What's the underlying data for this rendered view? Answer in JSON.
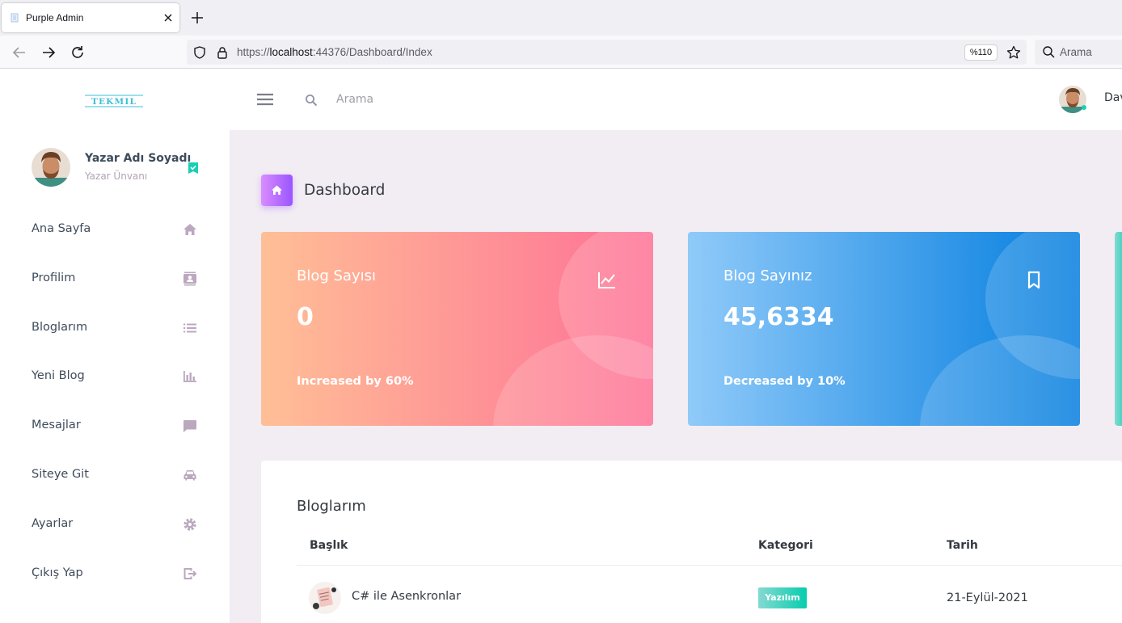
{
  "browser": {
    "tab_title": "Purple Admin",
    "url_scheme": "https://",
    "url_host": "localhost",
    "url_path": ":44376/Dashboard/Index",
    "zoom": "%110",
    "search_placeholder": "Arama"
  },
  "header": {
    "logo_text": "TEKMIL",
    "search_placeholder": "Arama",
    "user_name": "Dav"
  },
  "sidebar": {
    "user_name": "Yazar Adı Soyadı",
    "user_title": "Yazar Ünvanı",
    "items": [
      {
        "label": "Ana Sayfa",
        "icon": "home-icon"
      },
      {
        "label": "Profilim",
        "icon": "contacts-icon"
      },
      {
        "label": "Bloglarım",
        "icon": "format-list-icon"
      },
      {
        "label": "Yeni Blog",
        "icon": "chart-bar-icon"
      },
      {
        "label": "Mesajlar",
        "icon": "message-icon"
      },
      {
        "label": "Siteye Git",
        "icon": "car-icon"
      },
      {
        "label": "Ayarlar",
        "icon": "settings-icon"
      },
      {
        "label": "Çıkış Yap",
        "icon": "logout-icon"
      }
    ]
  },
  "page": {
    "title": "Dashboard"
  },
  "cards": [
    {
      "title": "Blog Sayısı",
      "value": "0",
      "footer": "Increased by 60%",
      "icon": "chart-line-icon"
    },
    {
      "title": "Blog Sayınız",
      "value": "45,6334",
      "footer": "Decreased by 10%",
      "icon": "bookmark-icon"
    }
  ],
  "blogs_table": {
    "title": "Bloglarım",
    "columns": [
      "Başlık",
      "Kategori",
      "Tarih"
    ],
    "rows": [
      {
        "title": "C# ile Asenkronlar",
        "category": "Yazılım",
        "date": "21-Eylül-2021"
      }
    ]
  },
  "colors": {
    "accent_purple": "#9a55ff",
    "card_danger_from": "#ffbf96",
    "card_danger_to": "#fe7096",
    "card_info_from": "#90caf9",
    "card_info_to": "#047edf",
    "badge_success": "#07cdae"
  }
}
